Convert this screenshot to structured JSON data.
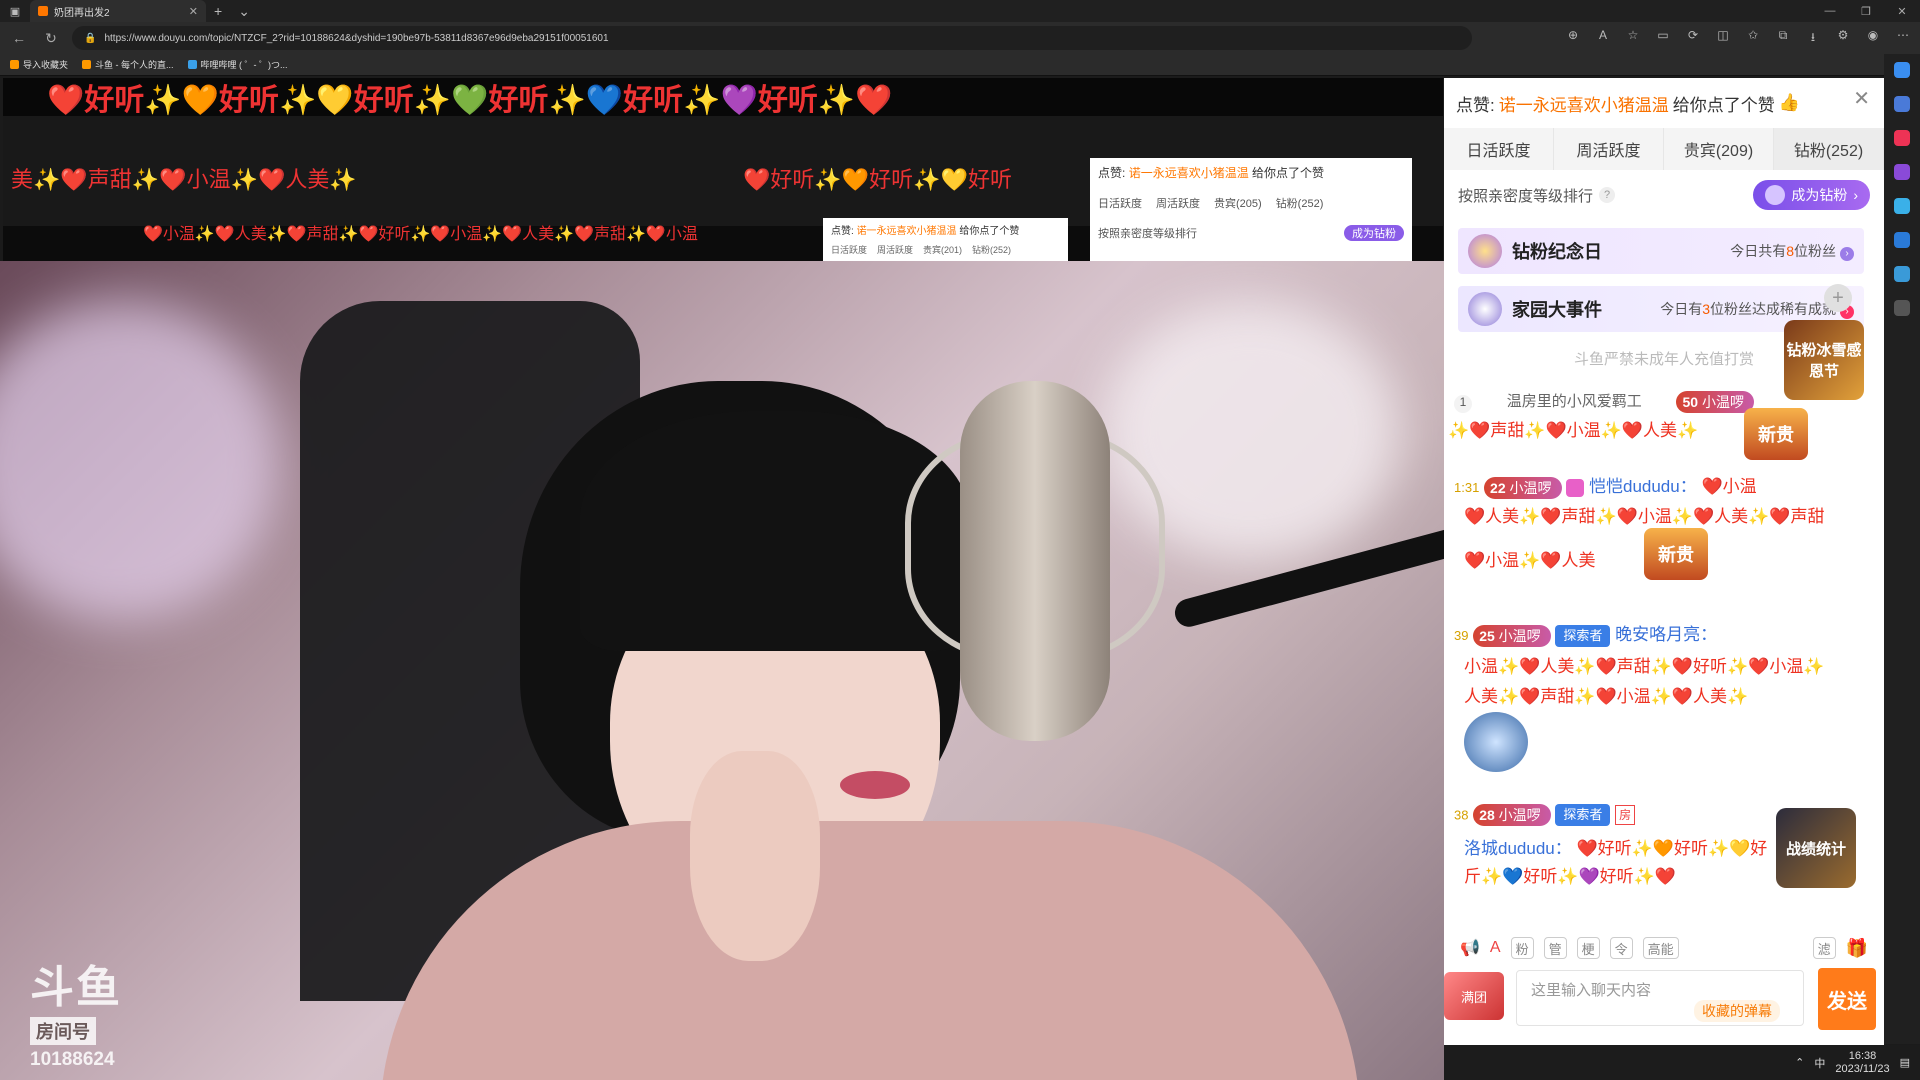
{
  "browser": {
    "tab_title": "奶团再出发2",
    "url": "https://www.douyu.com/topic/NTZCF_2?rid=10188624&dyshid=190be97b-53811d8367e96d9eba29151f00051601",
    "bookmarks": [
      "导入收藏夹",
      "斗鱼 - 每个人的直...",
      "哔哩哔哩 ( ゜- ゜)つ..."
    ]
  },
  "nested": {
    "strip1": "❤️好听✨🧡好听✨💛好听✨💚好听✨💙好听✨💜好听✨❤️",
    "row2": "美✨❤️声甜✨❤️小温✨❤️人美✨",
    "row2b": "❤️好听✨🧡好听✨💛好听",
    "row3": "❤️小温✨❤️人美✨❤️声甜✨❤️好听✨❤️小温✨❤️人美✨❤️声甜✨❤️小温",
    "like_prefix": "点赞:",
    "like_name": "诺一永远喜欢小猪温温",
    "like_suffix": "给你点了个赞",
    "tabs": [
      "日活跃度",
      "周活跃度",
      "贵宾(205)",
      "钻粉(252)"
    ],
    "tabs_small": [
      "日活跃度",
      "周活跃度",
      "贵宾(201)",
      "钻粉(252)"
    ],
    "rank": "按照亲密度等级排行",
    "become": "成为钻粉"
  },
  "video": {
    "logo_top": "斗鱼",
    "logo_mid": "房间号",
    "room_id": "10188624"
  },
  "panel": {
    "like_prefix": "点赞:",
    "like_name": "诺一永远喜欢小猪温温",
    "like_suffix": "给你点了个赞",
    "tabs": [
      "日活跃度",
      "周活跃度",
      "贵宾(209)",
      "钻粉(252)"
    ],
    "rank_label": "按照亲密度等级排行",
    "become_btn": "成为钻粉",
    "banner1": {
      "title": "钻粉纪念日",
      "right_prefix": "今日共有",
      "num": "8",
      "right_suffix": "位粉丝"
    },
    "banner2": {
      "title": "家园大事件",
      "right_prefix": "今日有",
      "num": "3",
      "right_suffix": "位粉丝达成稀有成就"
    },
    "notice": "斗鱼严禁未成年人充值打赏",
    "rank1": {
      "pos": "1",
      "name": "温房里的小风爱羁工",
      "level": "50",
      "fan": "小温啰"
    },
    "msg1": "✨❤️声甜✨❤️小温✨❤️人美✨",
    "msg2": {
      "time": "1:31",
      "level": "22",
      "fan": "小温啰",
      "user": "恺恺dududu：",
      "text": "❤️小温"
    },
    "msg2b": "❤️人美✨❤️声甜✨❤️小温✨❤️人美✨❤️声甜",
    "msg2c": "❤️小温✨❤️人美",
    "msg3": {
      "time": "39",
      "level": "25",
      "fan": "小温啰",
      "explorer": "探索者",
      "user": "晚安咯月亮："
    },
    "msg3b": "小温✨❤️人美✨❤️声甜✨❤️好听✨❤️小温✨",
    "msg3c": "人美✨❤️声甜✨❤️小温✨❤️人美✨",
    "msg4": {
      "time": "38",
      "level": "28",
      "fan": "小温啰",
      "explorer": "探索者",
      "house": "房"
    },
    "msg4b_user": "洛城dududu：",
    "msg4b": "❤️好听✨🧡好听✨💛好",
    "msg4c": "斤✨💙好听✨💜好听✨❤️",
    "badge_new": "新贵",
    "promo1": "钻粉冰雪感恩节",
    "promo2": "战绩统计",
    "toolbar": [
      "粉",
      "管",
      "梗",
      "令",
      "高能"
    ],
    "toolbar_right": "滤",
    "fanclub": "满",
    "fanclub_sub": "团",
    "input_placeholder": "这里输入聊天内容",
    "collect": "收藏的弹幕",
    "send": "发送"
  },
  "taskbar": {
    "ime": "中",
    "time": "16:38",
    "date": "2023/11/23"
  }
}
